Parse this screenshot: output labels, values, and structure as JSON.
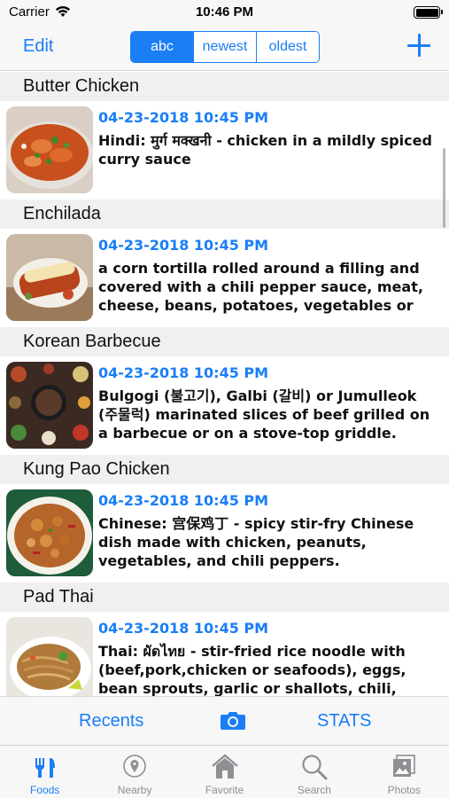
{
  "status": {
    "carrier": "Carrier",
    "time": "10:46 PM"
  },
  "nav": {
    "edit_label": "Edit",
    "segments": [
      {
        "label": "abc",
        "selected": true
      },
      {
        "label": "newest",
        "selected": false
      },
      {
        "label": "oldest",
        "selected": false
      }
    ]
  },
  "foods": [
    {
      "name": "Butter Chicken",
      "date": "04-23-2018 10:45 PM",
      "description": "Hindi: मुर्ग मक्खनी - chicken in a mildly spiced curry sauce"
    },
    {
      "name": "Enchilada",
      "date": "04-23-2018 10:45 PM",
      "description": "a corn tortilla rolled around a filling and covered with a chili pepper sauce, meat, cheese, beans, potatoes, vegetables or co..."
    },
    {
      "name": "Korean Barbecue",
      "date": "04-23-2018 10:45 PM",
      "description": "Bulgogi (불고기), Galbi (갈비) or Jumulleok (주물럭) marinated slices of beef grilled on a barbecue or on a stove-top griddle."
    },
    {
      "name": "Kung Pao Chicken",
      "date": "04-23-2018 10:45 PM",
      "description": "Chinese: 宫保鸡丁 - spicy stir-fry Chinese dish made with chicken, peanuts, vegetables, and chili peppers."
    },
    {
      "name": "Pad Thai",
      "date": "04-23-2018 10:45 PM",
      "description": "Thai: ผัดไทย - stir-fried rice noodle with (beef,pork,chicken or seafoods), eggs, bean sprouts, garlic or shallots, chili, roasted pe..."
    }
  ],
  "actions": {
    "recents_label": "Recents",
    "stats_label": "STATS"
  },
  "tabs": [
    {
      "label": "Foods",
      "active": true,
      "icon": "fork-knife-icon"
    },
    {
      "label": "Nearby",
      "active": false,
      "icon": "location-pin-icon"
    },
    {
      "label": "Favorite",
      "active": false,
      "icon": "house-icon"
    },
    {
      "label": "Search",
      "active": false,
      "icon": "search-icon"
    },
    {
      "label": "Photos",
      "active": false,
      "icon": "photos-icon"
    }
  ],
  "colors": {
    "accent": "#1a7ef5",
    "inactive": "#8e8e93",
    "section_bg": "#f0f0f2",
    "bar_bg": "#f7f7f7"
  }
}
